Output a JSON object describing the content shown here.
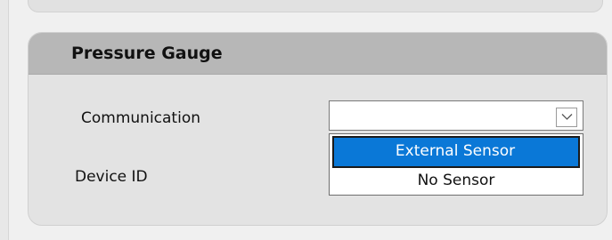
{
  "group": {
    "title": "Pressure Gauge"
  },
  "fields": {
    "communication_label": "Communication",
    "device_id_label": "Device ID"
  },
  "communication_combo": {
    "value": "",
    "arrow_icon": "chevron-down-icon"
  },
  "dropdown": {
    "options": [
      {
        "label": "External Sensor",
        "selected": true
      },
      {
        "label": "No Sensor",
        "selected": false
      }
    ]
  },
  "colors": {
    "selection_bg": "#0a78d7",
    "header_bg": "#b7b7b7",
    "panel_bg": "#e3e3e3"
  }
}
